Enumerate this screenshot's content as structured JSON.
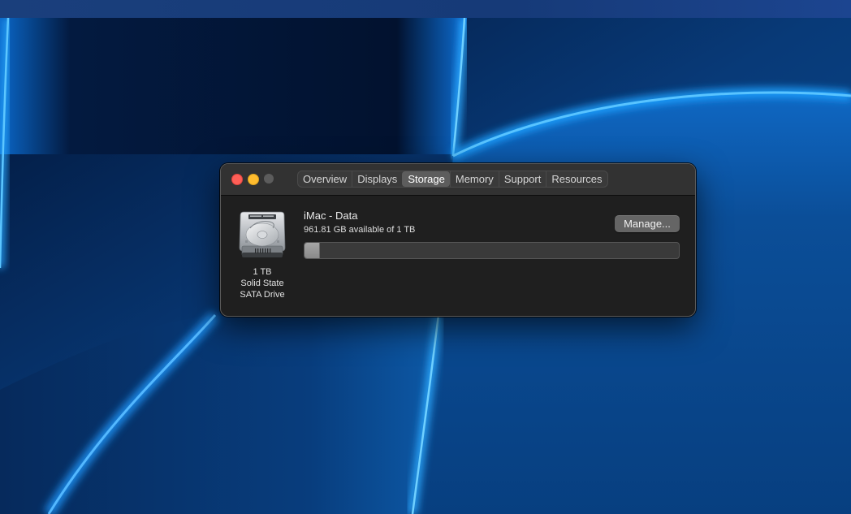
{
  "window": {
    "tabs": [
      {
        "label": "Overview",
        "active": false
      },
      {
        "label": "Displays",
        "active": false
      },
      {
        "label": "Storage",
        "active": true
      },
      {
        "label": "Memory",
        "active": false
      },
      {
        "label": "Support",
        "active": false
      },
      {
        "label": "Resources",
        "active": false
      }
    ]
  },
  "drive": {
    "capacity": "1 TB",
    "type_line1": "Solid State",
    "type_line2": "SATA Drive",
    "icon": "hard-drive-icon"
  },
  "volume": {
    "name": "iMac - Data",
    "available": "961.81 GB available of 1 TB",
    "used_fraction": 0.038
  },
  "actions": {
    "manage_label": "Manage..."
  },
  "colors": {
    "close": "#fe5f57",
    "minimize": "#febc2e",
    "zoom_disabled": "#5c5c5c",
    "window_bg": "#1f1f1f",
    "titlebar_bg": "#323232"
  }
}
